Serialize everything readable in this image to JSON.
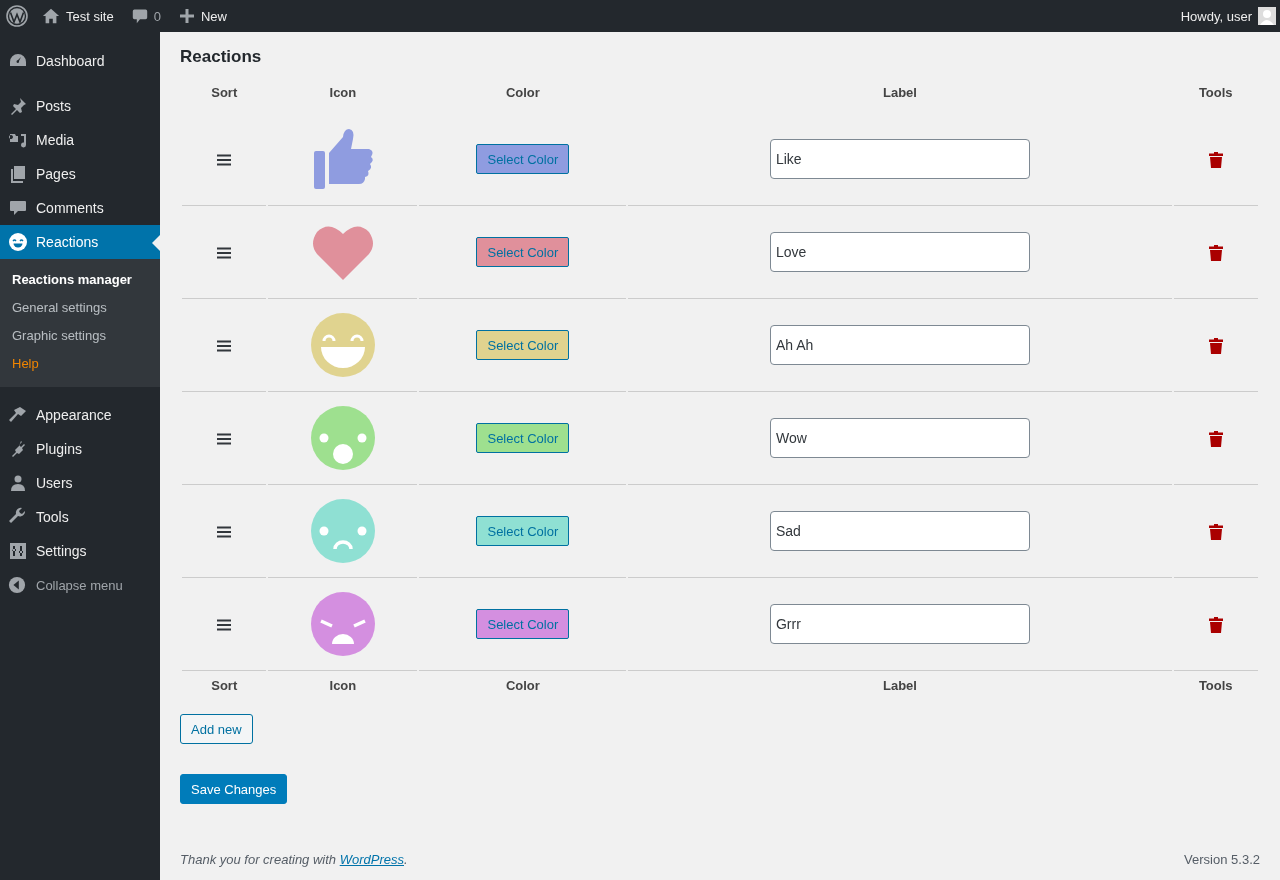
{
  "admin_bar": {
    "site": "Test site",
    "comments_count": "0",
    "new_label": "New",
    "greeting": "Howdy, user"
  },
  "menu": {
    "items": [
      {
        "kind": "dashboard",
        "label": "Dashboard",
        "selected": false
      },
      {
        "kind": "posts",
        "label": "Posts",
        "selected": false
      },
      {
        "kind": "media",
        "label": "Media",
        "selected": false
      },
      {
        "kind": "pages",
        "label": "Pages",
        "selected": false
      },
      {
        "kind": "comments",
        "label": "Comments",
        "selected": false
      },
      {
        "kind": "reactions",
        "label": "Reactions",
        "selected": true,
        "children": [
          {
            "kind": "link",
            "label": "Reactions manager",
            "selected": true
          },
          {
            "kind": "link",
            "label": "General settings",
            "selected": false
          },
          {
            "kind": "link",
            "label": "Graphic settings",
            "selected": false
          },
          {
            "kind": "help",
            "label": "Help",
            "selected": false
          }
        ]
      },
      {
        "kind": "appearance",
        "label": "Appearance",
        "selected": false
      },
      {
        "kind": "plugins",
        "label": "Plugins",
        "selected": false
      },
      {
        "kind": "users",
        "label": "Users",
        "selected": false
      },
      {
        "kind": "tools",
        "label": "Tools",
        "selected": false
      },
      {
        "kind": "settings",
        "label": "Settings",
        "selected": false
      }
    ],
    "collapse": "Collapse menu"
  },
  "page_title": "Reactions",
  "table": {
    "columns": [
      "Sort",
      "Icon",
      "Color",
      "Label",
      "Tools"
    ],
    "rows": [
      {
        "kind": "like",
        "color": "#8f9ce0",
        "button": "Select Color",
        "label": "Like"
      },
      {
        "kind": "love",
        "color": "#e0909b",
        "button": "Select Color",
        "label": "Love"
      },
      {
        "kind": "haha",
        "color": "#e0d38f",
        "button": "Select Color",
        "label": "Ah Ah"
      },
      {
        "kind": "wow",
        "color": "#9ee08f",
        "button": "Select Color",
        "label": "Wow"
      },
      {
        "kind": "sad",
        "color": "#8fe0d3",
        "button": "Select Color",
        "label": "Sad"
      },
      {
        "kind": "angry",
        "color": "#d48fe0",
        "button": "Select Color",
        "label": "Grrr"
      }
    ],
    "footer_columns": [
      "Sort",
      "Icon",
      "Color",
      "Label",
      "Tools"
    ]
  },
  "add_button": "Add new",
  "save_button": "Save Changes",
  "footer": {
    "text_before": "Thank you for creating with ",
    "link": "WordPress",
    "text_after": ".",
    "version": "Version 5.3.2"
  }
}
